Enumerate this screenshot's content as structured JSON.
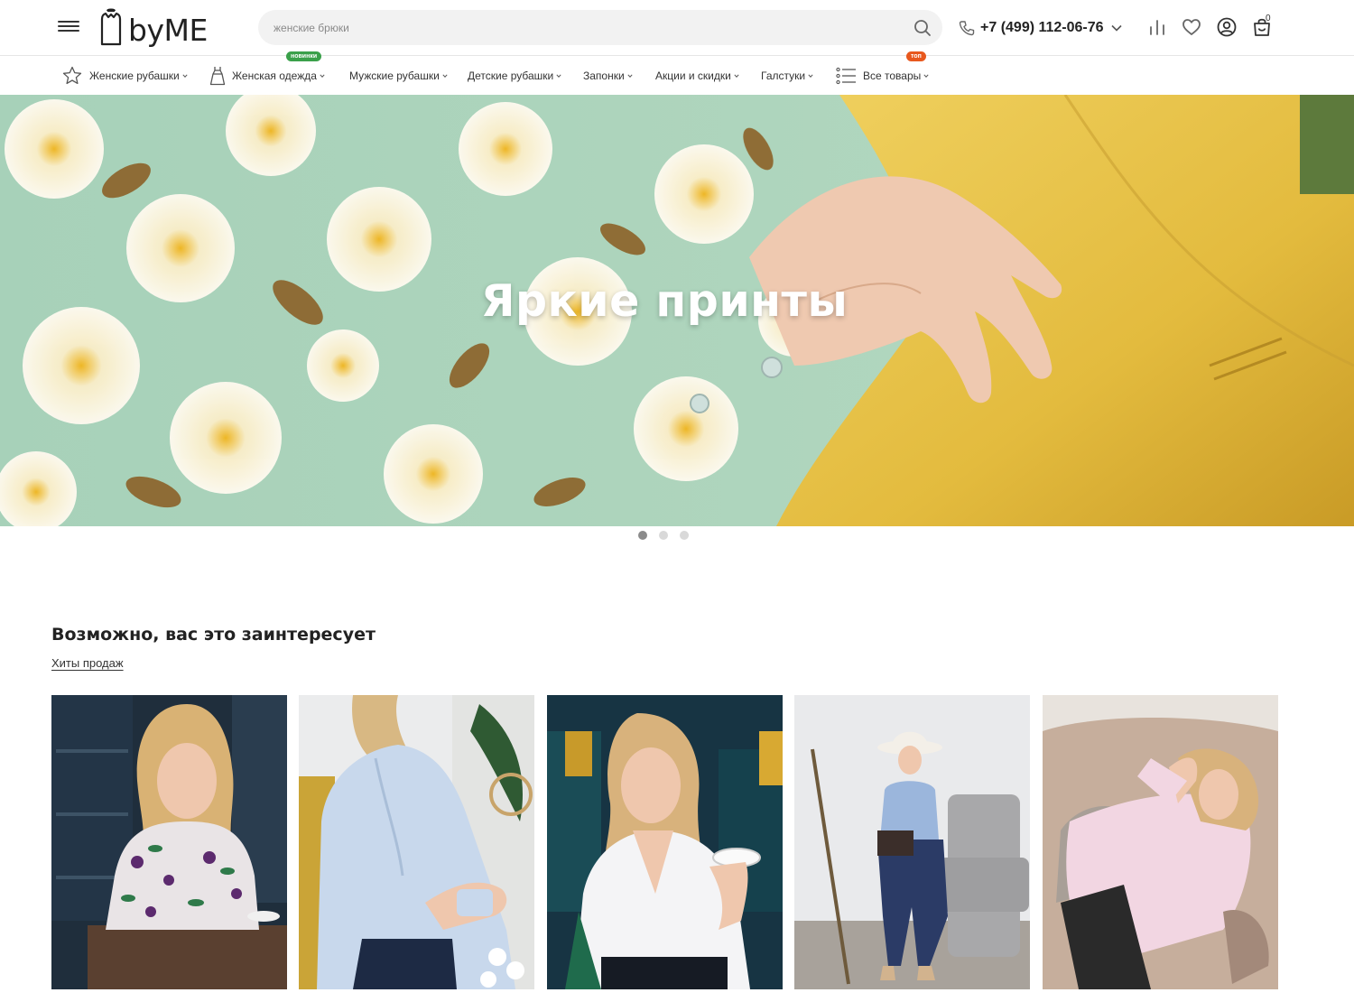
{
  "brand": {
    "logo_text": "byME"
  },
  "search": {
    "placeholder": "женские брюки"
  },
  "phone": {
    "number": "+7 (499) 112-06-76"
  },
  "header_icons": [
    "compare-icon",
    "heart-icon",
    "user-icon",
    "cart-icon"
  ],
  "cart": {
    "count": "0"
  },
  "menu": {
    "items": [
      {
        "label": "Женские рубашки",
        "icon": "star-badge-icon"
      },
      {
        "label": "Женская одежда",
        "icon": "dress-icon",
        "pill": "новинки"
      },
      {
        "label": "Мужские рубашки"
      },
      {
        "label": "Детские рубашки"
      },
      {
        "label": "Запонки"
      },
      {
        "label": "Акции и скидки"
      },
      {
        "label": "Галстуки"
      },
      {
        "label": "Все товары",
        "icon": "list-icon",
        "pill": "топ"
      }
    ]
  },
  "hero": {
    "title": "Яркие принты",
    "slides": 3,
    "active_slide": 1
  },
  "section": {
    "title": "Возможно, вас это заинтересует",
    "link": "Хиты продаж"
  },
  "colors": {
    "accent_green": "#3aa04a",
    "accent_orange": "#e8581e",
    "search_bg": "#f2f2f2"
  }
}
